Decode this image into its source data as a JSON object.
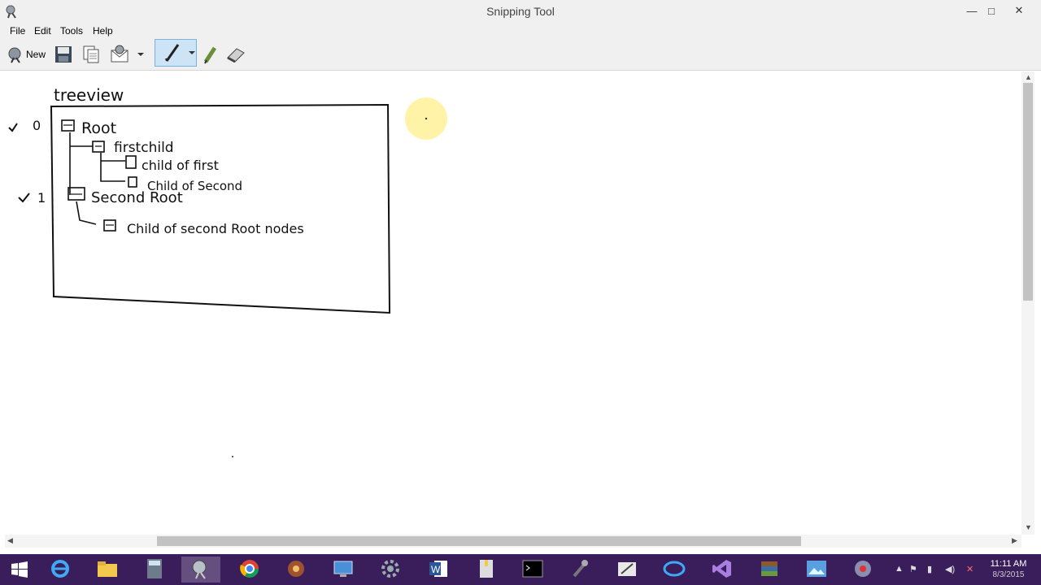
{
  "window": {
    "title": "Snipping Tool",
    "controls": {
      "minimize": "—",
      "maximize": "□",
      "close": "✕"
    }
  },
  "menu": {
    "items": [
      "File",
      "Edit",
      "Tools",
      "Help"
    ]
  },
  "toolbar": {
    "new_label": "New"
  },
  "drawing": {
    "heading": "treeview",
    "marks": [
      "0",
      "1"
    ],
    "nodes": {
      "root": "Root",
      "first_child": "firstchild",
      "child_of_first": "child of first",
      "child_of_second": "Child of Second",
      "second_root": "Second Root",
      "child_of_second_root": "Child of second Root nodes"
    },
    "ink_color": "#111111",
    "cursor_highlight_color": "#fff3a8"
  },
  "taskbar": {
    "apps": [
      "start",
      "internet-explorer",
      "file-explorer",
      "calculator",
      "snipping-tool",
      "chrome",
      "media-app",
      "remote-desktop",
      "settings-app",
      "word",
      "file-app",
      "command-prompt",
      "microphone",
      "paint",
      "swirl-app",
      "visual-studio",
      "archive-app",
      "photos",
      "network-app"
    ],
    "clock_time": "11:11 AM",
    "clock_date": "8/3/2015"
  }
}
